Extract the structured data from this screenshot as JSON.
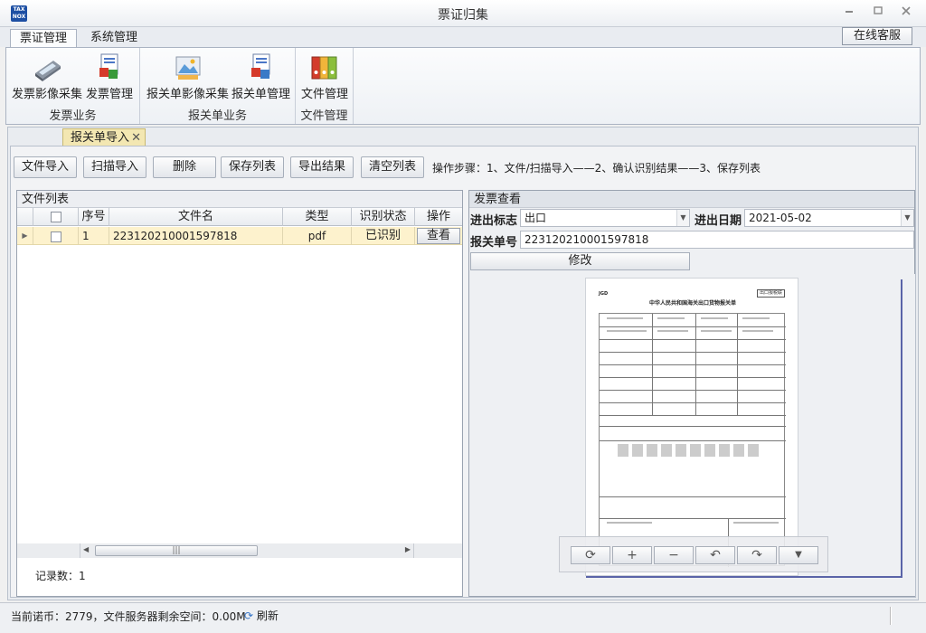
{
  "window": {
    "title": "票证归集",
    "icon_text": "TAX NOX",
    "controls": {
      "minimize": "▭",
      "restore": "⧉",
      "close": "⊠"
    }
  },
  "ribbon": {
    "tabs": [
      {
        "label": "票证管理"
      },
      {
        "label": "系统管理"
      }
    ],
    "online_service": "在线客服",
    "groups": [
      {
        "label": "发票业务",
        "buttons": [
          {
            "label": "发票影像采集",
            "icon": "scanner-icon"
          },
          {
            "label": "发票管理",
            "icon": "invoice-manage-icon"
          }
        ]
      },
      {
        "label": "报关单业务",
        "buttons": [
          {
            "label": "报关单影像采集",
            "icon": "image-capture-icon"
          },
          {
            "label": "报关单管理",
            "icon": "customs-manage-icon"
          }
        ]
      },
      {
        "label": "文件管理",
        "buttons": [
          {
            "label": "文件管理",
            "icon": "binders-icon"
          }
        ]
      }
    ]
  },
  "doc_tab": {
    "label": "报关单导入",
    "close": "✕"
  },
  "toolbar": {
    "buttons": [
      "文件导入",
      "扫描导入",
      "删除",
      "保存列表",
      "导出结果",
      "清空列表"
    ],
    "steps": "操作步骤：1、文件/扫描导入——2、确认识别结果——3、保存列表"
  },
  "file_list": {
    "title": "文件列表",
    "columns": [
      "序号",
      "文件名",
      "类型",
      "识别状态",
      "操作"
    ],
    "rows": [
      {
        "seq": "1",
        "filename": "223120210001597818",
        "type": "pdf",
        "status": "已识别",
        "action": "查看"
      }
    ],
    "record_count": "记录数：1"
  },
  "invoice_view": {
    "title": "发票查看",
    "direction_label": "进出标志",
    "direction_value": "出口",
    "date_label": "进出日期",
    "date_value": "2021-05-02",
    "customs_label": "报关单号",
    "customs_value": "223120210001597818",
    "modify_btn": "修改",
    "doc_title": "中华人民共和国海关出口货物报关单",
    "doc_stamp": "出口报税联"
  },
  "image_tools": [
    "rotate-icon",
    "zoom-in-icon",
    "zoom-out-icon",
    "undo-icon",
    "redo-icon",
    "dropdown-icon"
  ],
  "status_bar": {
    "text": "当前诺币：2779，文件服务器剩余空间：0.00M",
    "refresh": "刷新"
  }
}
